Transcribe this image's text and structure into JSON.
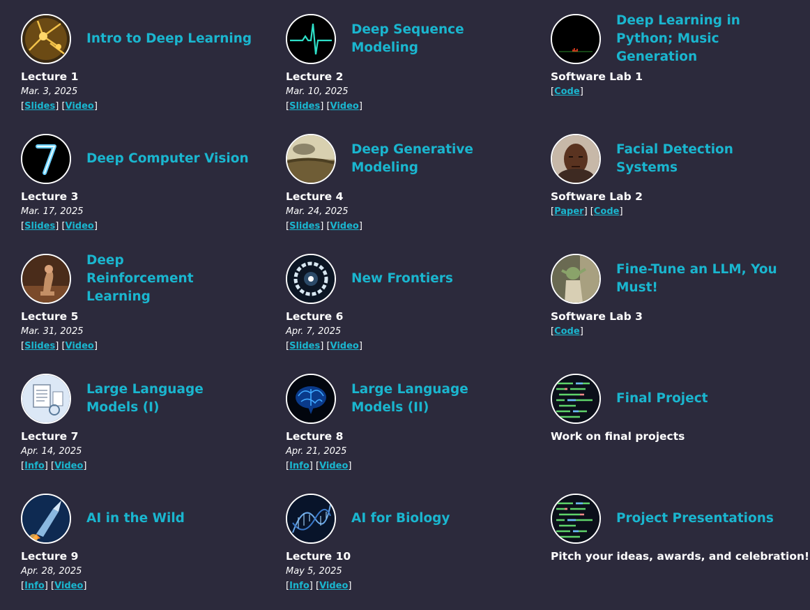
{
  "accent_color": "#1ab6cf",
  "background_color": "#2c2a3c",
  "cards": [
    {
      "title": "Intro to Deep Learning",
      "label": "Lecture 1",
      "date": "Mar. 3, 2025",
      "links": [
        "Slides",
        "Video"
      ],
      "icon": "neurons-image"
    },
    {
      "title": "Deep Sequence Modeling",
      "label": "Lecture 2",
      "date": "Mar. 10, 2025",
      "links": [
        "Slides",
        "Video"
      ],
      "icon": "heartbeat-image"
    },
    {
      "title": "Deep Learning in Python; Music Generation",
      "label": "Software Lab 1",
      "date": "",
      "links": [
        "Code"
      ],
      "icon": "audio-waveform-image"
    },
    {
      "title": "Deep Computer Vision",
      "label": "Lecture 3",
      "date": "Mar. 17, 2025",
      "links": [
        "Slides",
        "Video"
      ],
      "icon": "digit-seven-image"
    },
    {
      "title": "Deep Generative Modeling",
      "label": "Lecture 4",
      "date": "Mar. 24, 2025",
      "links": [
        "Slides",
        "Video"
      ],
      "icon": "landscape-painting-image"
    },
    {
      "title": "Facial Detection Systems",
      "label": "Software Lab 2",
      "date": "",
      "links": [
        "Paper",
        "Code"
      ],
      "icon": "face-image"
    },
    {
      "title": "Deep Reinforcement Learning",
      "label": "Lecture 5",
      "date": "Mar. 31, 2025",
      "links": [
        "Slides",
        "Video"
      ],
      "icon": "chess-image"
    },
    {
      "title": "New Frontiers",
      "label": "Lecture 6",
      "date": "Apr. 7, 2025",
      "links": [
        "Slides",
        "Video"
      ],
      "icon": "frontier-ring-image"
    },
    {
      "title": "Fine-Tune an LLM, You Must!",
      "label": "Software Lab 3",
      "date": "",
      "links": [
        "Code"
      ],
      "icon": "yoda-image"
    },
    {
      "title": "Large Language Models (I)",
      "label": "Lecture 7",
      "date": "Apr. 14, 2025",
      "links": [
        "Info",
        "Video"
      ],
      "icon": "documents-image"
    },
    {
      "title": "Large Language Models (II)",
      "label": "Lecture 8",
      "date": "Apr. 21, 2025",
      "links": [
        "Info",
        "Video"
      ],
      "icon": "brain-image"
    },
    {
      "title": "Final Project",
      "label": "Work on final projects",
      "date": "",
      "links": [],
      "icon": "code-screen-image"
    },
    {
      "title": "AI in the Wild",
      "label": "Lecture 9",
      "date": "Apr. 28, 2025",
      "links": [
        "Info",
        "Video"
      ],
      "icon": "rocket-image"
    },
    {
      "title": "AI for Biology",
      "label": "Lecture 10",
      "date": "May 5, 2025",
      "links": [
        "Info",
        "Video"
      ],
      "icon": "dna-image"
    },
    {
      "title": "Project Presentations",
      "label": "Pitch your ideas, awards, and celebration!",
      "date": "",
      "links": [],
      "icon": "code-screen-image"
    }
  ]
}
